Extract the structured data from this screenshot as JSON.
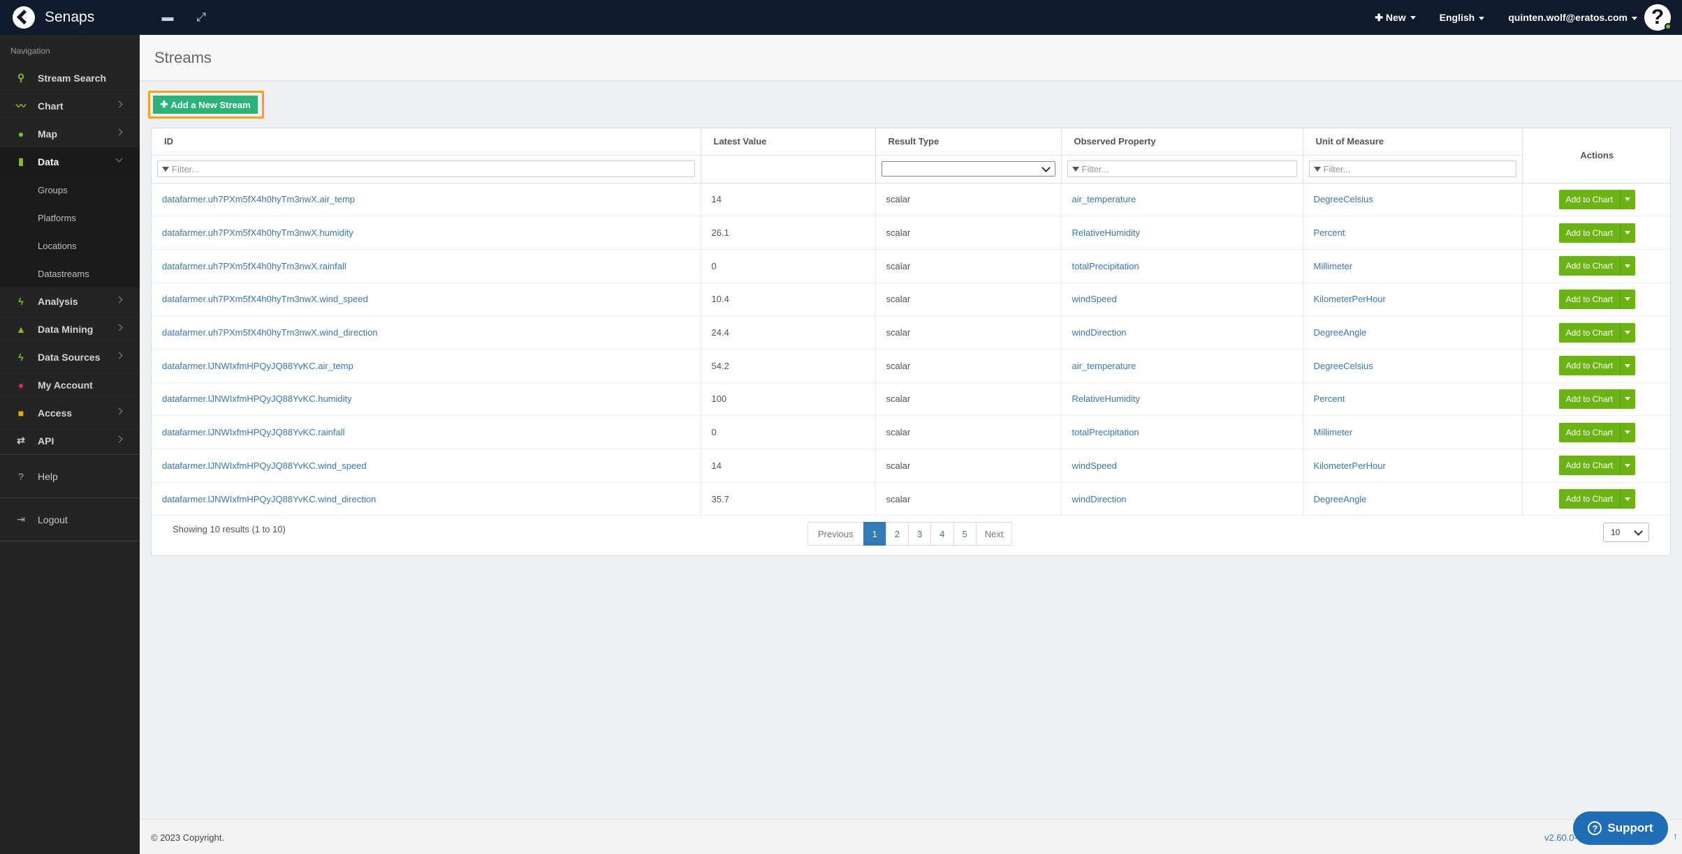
{
  "app": {
    "name": "Senaps"
  },
  "topbar": {
    "new_label": "New",
    "language": "English",
    "user": "quinten.wolf@eratos.com",
    "avatar_glyph": "?"
  },
  "sidebar": {
    "heading": "Navigation",
    "items": [
      {
        "label": "Stream Search",
        "icon": "search-icon",
        "color": "#7dc420"
      },
      {
        "label": "Chart",
        "icon": "line-chart-icon",
        "color": "#7dc420"
      },
      {
        "label": "Map",
        "icon": "map-pin-icon",
        "color": "#7dc420"
      },
      {
        "label": "Data",
        "icon": "bar-chart-icon",
        "color": "#7dc420"
      },
      {
        "label": "Analysis",
        "icon": "bolt-icon",
        "color": "#7dc420"
      },
      {
        "label": "Data Mining",
        "icon": "flask-icon",
        "color": "#7dc420"
      },
      {
        "label": "Data Sources",
        "icon": "bolt-icon",
        "color": "#7dc420"
      },
      {
        "label": "My Account",
        "icon": "user-icon",
        "color": "#e0237a"
      },
      {
        "label": "Access",
        "icon": "lock-icon",
        "color": "#f0a70b"
      },
      {
        "label": "API",
        "icon": "retweet-icon",
        "color": "#cccccc"
      }
    ],
    "data_sub": [
      "Groups",
      "Platforms",
      "Locations",
      "Datastreams"
    ],
    "help": "Help",
    "logout": "Logout"
  },
  "page": {
    "title": "Streams",
    "add_button": "Add a New Stream"
  },
  "table": {
    "columns": [
      "ID",
      "Latest Value",
      "Result Type",
      "Observed Property",
      "Unit of Measure",
      "Actions"
    ],
    "filter_placeholder": "Filter...",
    "action_label": "Add to Chart",
    "rows": [
      {
        "id": "datafarmer.uh7PXm5fX4h0hyTm3nwX.air_temp",
        "value": "14",
        "type": "scalar",
        "property": "air_temperature",
        "unit": "DegreeCelsius"
      },
      {
        "id": "datafarmer.uh7PXm5fX4h0hyTm3nwX.humidity",
        "value": "26.1",
        "type": "scalar",
        "property": "RelativeHumidity",
        "unit": "Percent"
      },
      {
        "id": "datafarmer.uh7PXm5fX4h0hyTm3nwX.rainfall",
        "value": "0",
        "type": "scalar",
        "property": "totalPrecipitation",
        "unit": "Millimeter"
      },
      {
        "id": "datafarmer.uh7PXm5fX4h0hyTm3nwX.wind_speed",
        "value": "10.4",
        "type": "scalar",
        "property": "windSpeed",
        "unit": "KilometerPerHour"
      },
      {
        "id": "datafarmer.uh7PXm5fX4h0hyTm3nwX.wind_direction",
        "value": "24.4",
        "type": "scalar",
        "property": "windDirection",
        "unit": "DegreeAngle"
      },
      {
        "id": "datafarmer.lJNWIxfmHPQyJQ88YvKC.air_temp",
        "value": "54.2",
        "type": "scalar",
        "property": "air_temperature",
        "unit": "DegreeCelsius"
      },
      {
        "id": "datafarmer.lJNWIxfmHPQyJQ88YvKC.humidity",
        "value": "100",
        "type": "scalar",
        "property": "RelativeHumidity",
        "unit": "Percent"
      },
      {
        "id": "datafarmer.lJNWIxfmHPQyJQ88YvKC.rainfall",
        "value": "0",
        "type": "scalar",
        "property": "totalPrecipitation",
        "unit": "Millimeter"
      },
      {
        "id": "datafarmer.lJNWIxfmHPQyJQ88YvKC.wind_speed",
        "value": "14",
        "type": "scalar",
        "property": "windSpeed",
        "unit": "KilometerPerHour"
      },
      {
        "id": "datafarmer.lJNWIxfmHPQyJQ88YvKC.wind_direction",
        "value": "35.7",
        "type": "scalar",
        "property": "windDirection",
        "unit": "DegreeAngle"
      }
    ],
    "showing": "Showing 10 results (1 to 10)",
    "pager": {
      "prev": "Previous",
      "pages": [
        "1",
        "2",
        "3",
        "4",
        "5"
      ],
      "current": "1",
      "next": "Next"
    },
    "page_size": "10"
  },
  "footer": {
    "copyright": "© 2023 Copyright.",
    "version": "v2.60.0-",
    "support": "Support"
  }
}
